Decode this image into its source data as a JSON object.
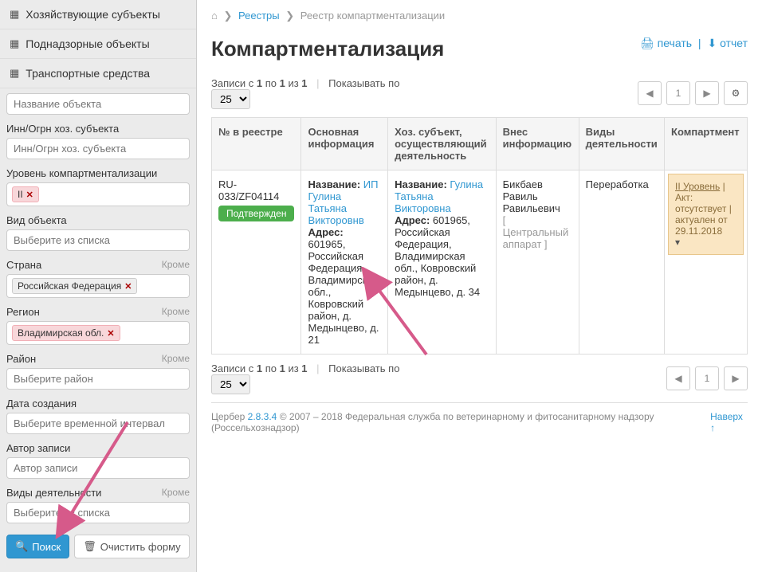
{
  "sidebar": {
    "sections": [
      {
        "icon": "👥",
        "label": "Хозяйствующие субъекты"
      },
      {
        "icon": "🏢",
        "label": "Поднадзорные объекты"
      },
      {
        "icon": "🚚",
        "label": "Транспортные средства"
      }
    ],
    "filters": {
      "name_ph": "Название объекта",
      "inn_label": "Инн/Огрн хоз. субъекта",
      "inn_ph": "Инн/Огрн хоз. субъекта",
      "level_label": "Уровень компартментализации",
      "level_tag": "II",
      "vidobj_label": "Вид объекта",
      "vidobj_ph": "Выберите из списка",
      "country_label": "Страна",
      "country_tag": "Российская Федерация",
      "region_label": "Регион",
      "region_tag": "Владимирская обл.",
      "rayon_label": "Район",
      "rayon_ph": "Выберите район",
      "date_label": "Дата создания",
      "date_ph": "Выберите временной интервал",
      "author_label": "Автор записи",
      "author_ph": "Автор записи",
      "vidd_label": "Виды деятельности",
      "vidd_ph": "Выберите из списка",
      "krome": "Кроме",
      "search_btn": "Поиск",
      "clear_btn": "Очистить форму"
    }
  },
  "breadcrumb": {
    "home": "⌂",
    "registries": "Реестры",
    "current": "Реестр компартментализации"
  },
  "page_title": "Компартментализация",
  "actions": {
    "print": "печать",
    "report": "отчет"
  },
  "records_text": {
    "prefix": "Записи с ",
    "from": "1",
    "mid1": " по ",
    "to": "1",
    "mid2": " из ",
    "total": "1",
    "show": "Показывать по"
  },
  "page_size": "25",
  "current_page": "1",
  "table": {
    "headers": [
      "№ в реестре",
      "Основная информация",
      "Хоз. субъект, осуществляющий деятельность",
      "Внес информацию",
      "Виды деятельности",
      "Компартмент"
    ],
    "row": {
      "num": "RU-033/ZF04114",
      "status": "Подтвержден",
      "info_name_label": "Название:",
      "info_name": "ИП Гулина Татьяна Викторовнв",
      "info_addr_label": "Адрес:",
      "info_addr": "601965, Российская Федерация, Владимирская обл., Ковровский район, д. Медынцево, д. 21",
      "subj_name_label": "Название:",
      "subj_name": "Гулина Татьяна Викторовна",
      "subj_addr_label": "Адрес:",
      "subj_addr": "601965, Российская Федерация, Владимирская обл., Ковровский район, д. Медынцево, д. 34",
      "who": "Бикбаев Равиль Равильевич",
      "who_org": "[ Центральный аппарат ]",
      "activity": "Переработка",
      "comp_level": "II Уровень",
      "comp_text": "Акт: отсутствует | актуален от 29.11.2018"
    }
  },
  "footer": {
    "name": "Цербер",
    "ver": "2.8.3.4",
    "copy": " © 2007 – 2018 Федеральная служба по ветеринарному и фитосанитарному надзору (Россельхознадзор)",
    "up": "Наверх"
  }
}
